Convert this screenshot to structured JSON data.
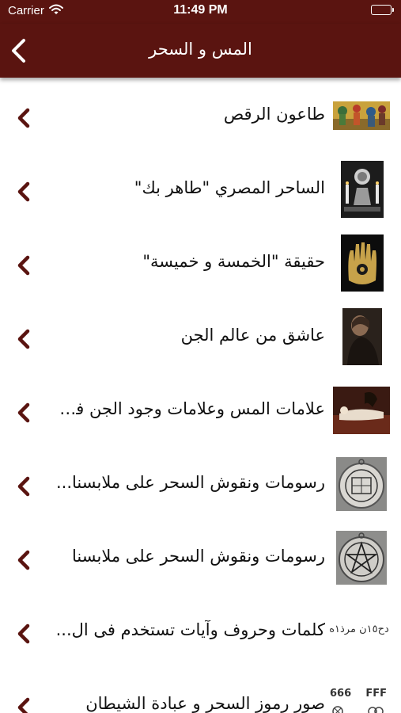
{
  "status_bar": {
    "carrier": "Carrier",
    "time": "11:49 PM",
    "battery_level": 1.0
  },
  "nav": {
    "title": "المس و السحر",
    "back_icon": "chevron-left-icon"
  },
  "colors": {
    "header": "#5a1410",
    "chevron": "#5a1410",
    "text": "#111111",
    "background": "#ffffff"
  },
  "list": {
    "items": [
      {
        "label": "طاعون الرقص",
        "thumb_icon": "dance-painting-thumb"
      },
      {
        "label": "الساحر المصري \"طاهر بك\"",
        "thumb_icon": "sorcerer-candles-thumb"
      },
      {
        "label": "حقيقة \"الخمسة و خميسة\"",
        "thumb_icon": "hamsa-hand-thumb"
      },
      {
        "label": "عاشق من عالم الجن",
        "thumb_icon": "dark-figure-thumb"
      },
      {
        "label": "علامات المس وعلامات وجود الجن فى...",
        "thumb_icon": "nightmare-painting-thumb"
      },
      {
        "label": "رسومات ونقوش السحر على ملابسنا...",
        "thumb_icon": "talisman-pendant-thumb"
      },
      {
        "label": "رسومات ونقوش السحر على ملابسنا",
        "thumb_icon": "pentagram-pendant-thumb"
      },
      {
        "label": "كلمات وحروف وآيات تستخدم فى ال...",
        "thumb_icon": "arabic-script-thumb",
        "thumb_text": "دح١٥ن مرذ١ه"
      },
      {
        "label": "صور رموز السحر و عبادة الشيطان",
        "thumb_icon": "occult-symbols-thumb",
        "thumb_text_a": "666",
        "thumb_text_b": "FFF"
      }
    ]
  }
}
